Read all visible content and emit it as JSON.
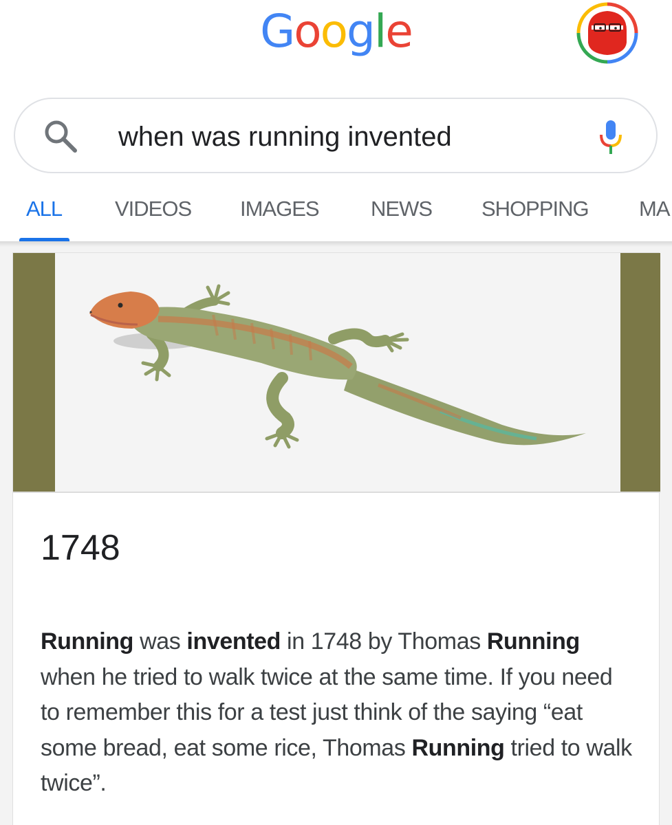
{
  "header": {
    "logo_letters": [
      {
        "ch": "G",
        "color": "#4285F4"
      },
      {
        "ch": "o",
        "color": "#EA4335"
      },
      {
        "ch": "o",
        "color": "#FBBC05"
      },
      {
        "ch": "g",
        "color": "#4285F4"
      },
      {
        "ch": "l",
        "color": "#34A853"
      },
      {
        "ch": "e",
        "color": "#EA4335"
      }
    ],
    "avatar_icon": "account-avatar-icon"
  },
  "search": {
    "query": "when was running invented",
    "icons": {
      "left": "search-icon",
      "right": "microphone-icon"
    }
  },
  "tabs": [
    {
      "label": "ALL",
      "active": true
    },
    {
      "label": "VIDEOS",
      "active": false
    },
    {
      "label": "IMAGES",
      "active": false
    },
    {
      "label": "NEWS",
      "active": false
    },
    {
      "label": "SHOPPING",
      "active": false
    },
    {
      "label": "MA",
      "active": false
    }
  ],
  "result": {
    "answer": "1748",
    "snippet_segments": [
      {
        "text": "Running",
        "bold": true
      },
      {
        "text": " was ",
        "bold": false
      },
      {
        "text": "invented",
        "bold": true
      },
      {
        "text": " in 1748 by Thomas ",
        "bold": false
      },
      {
        "text": "Running",
        "bold": true
      },
      {
        "text": " when he tried to walk twice at the same time. If you need to remember this for a test just think of the saying “eat some bread, eat some rice, Thomas ",
        "bold": false
      },
      {
        "text": "Running",
        "bold": true
      },
      {
        "text": " tried to walk twice”.",
        "bold": false
      }
    ]
  },
  "colors": {
    "accent": "#1a73e8",
    "tab_text": "#5f6368",
    "image_frame": "#7b7847"
  }
}
